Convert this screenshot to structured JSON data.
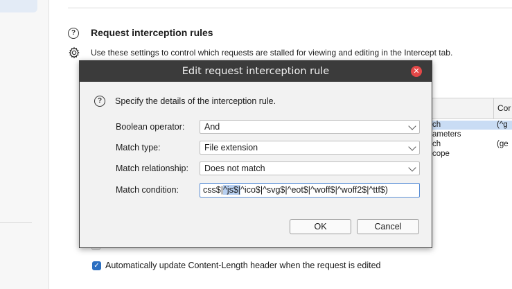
{
  "section": {
    "title": "Request interception rules",
    "description": "Use these settings to control which requests are stalled for viewing and editing in the Intercept tab."
  },
  "background_table": {
    "header_col2": "Cor",
    "rows": [
      {
        "col1": "ch",
        "col2": "(^g",
        "selected": true
      },
      {
        "col1": "ameters",
        "col2": ""
      },
      {
        "col1": "ch",
        "col2": "(ge"
      },
      {
        "col1": "cope",
        "col2": ""
      }
    ]
  },
  "option": {
    "checkbox_checked": true,
    "label": "Automatically update Content-Length header when the request is edited"
  },
  "dialog": {
    "title": "Edit request interception rule",
    "instruction": "Specify the details of the interception rule.",
    "fields": {
      "boolean_operator": {
        "label": "Boolean operator:",
        "value": "And"
      },
      "match_type": {
        "label": "Match type:",
        "value": "File extension"
      },
      "match_relationship": {
        "label": "Match relationship:",
        "value": "Does not match"
      },
      "match_condition": {
        "label": "Match condition:",
        "value_before": "css$|",
        "value_highlight": "^js$|",
        "value_after": "^ico$|^svg$|^eot$|^woff$|^woff2$|^ttf$)"
      }
    },
    "ok_label": "OK",
    "cancel_label": "Cancel"
  },
  "colors": {
    "title_bar": "#3b3b3b",
    "close_button": "#e34848",
    "accent": "#2c6fc1",
    "selection": "#c9dcf4"
  }
}
